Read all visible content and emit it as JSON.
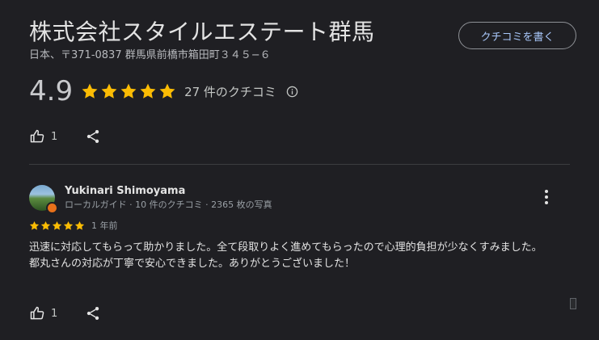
{
  "header": {
    "title": "株式会社スタイルエステート群馬",
    "address": "日本、〒371-0837 群馬県前橋市箱田町３４５−６",
    "write_review_label": "クチコミを書く"
  },
  "summary": {
    "rating": "4.9",
    "stars": 5,
    "review_count_label": "27 件のクチコミ",
    "like_count": "1",
    "icons": [
      "star-icon",
      "info-icon",
      "thumb-up-icon",
      "share-icon"
    ]
  },
  "review": {
    "author": "Yukinari Shimoyama",
    "meta": "ローカルガイド · 10 件のクチコミ · 2365 枚の写真",
    "stars": 5,
    "date": "1 年前",
    "text_line1": "迅速に対応してもらって助かりました。全て段取りよく進めてもらったので心理的負担が少なくすみました。",
    "text_line2": "都丸さんの対応が丁寧で安心できました。ありがとうございました！",
    "like_count": "1"
  },
  "colors": {
    "background": "#1f1f23",
    "star": "#fbbc04",
    "link": "#a8c7fa",
    "badge": "#e8711a"
  }
}
